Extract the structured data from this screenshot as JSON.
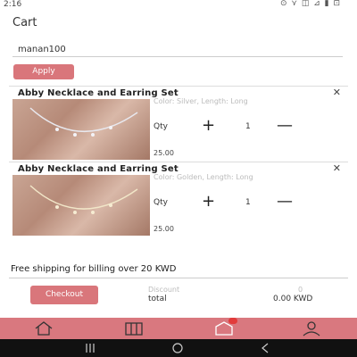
{
  "status_bar": {
    "time": "2:16",
    "icons": "⊙ ⋎ ◫ ⊿ ▮ ⊡"
  },
  "page": {
    "title": "Cart"
  },
  "coupon": {
    "value": "manan100",
    "apply_label": "Apply"
  },
  "items": [
    {
      "name": "Abby Necklace and Earring Set",
      "description": "Color: Silver, Length: Long",
      "qty_label": "Qty",
      "qty": "1",
      "price": "25.00"
    },
    {
      "name": "Abby Necklace and Earring Set",
      "description": "Color: Golden, Length: Long",
      "qty_label": "Qty",
      "qty": "1",
      "price": "25.00"
    }
  ],
  "footer": {
    "shipping_note": "Free shipping for billing over 20 KWD",
    "checkout_label": "Checkout",
    "discount_label": "Discount",
    "discount_value": "0",
    "total_label": "total",
    "total_value": "0.00 KWD"
  },
  "bottom_nav": [
    {
      "icon": "home-icon"
    },
    {
      "icon": "catalog-icon"
    },
    {
      "icon": "cart-icon",
      "badge": true
    },
    {
      "icon": "profile-icon"
    }
  ],
  "colors": {
    "accent": "#d9767b",
    "nav_bar": "#d9787f",
    "badge": "#e23b3b"
  }
}
